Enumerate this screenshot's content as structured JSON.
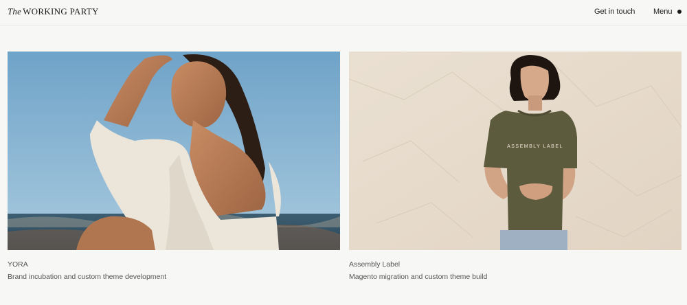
{
  "header": {
    "logo_the": "The",
    "logo_name": "WORKING PARTY",
    "contact_label": "Get in touch",
    "menu_label": "Menu"
  },
  "projects": [
    {
      "title": "YORA",
      "description": "Brand incubation and custom theme development",
      "image_alt": "Smiling woman in linen shirt shading her eyes by the sea"
    },
    {
      "title": "Assembly Label",
      "description": "Magento migration and custom theme build",
      "image_alt": "Woman wearing an olive Assembly Label t-shirt against crumpled paper backdrop",
      "shirt_text": "ASSEMBLY LABEL"
    }
  ],
  "colors": {
    "background": "#f7f7f5",
    "text": "#1a1a1a",
    "muted_text": "#555555",
    "sky": "#8fb8d3",
    "linen": "#ece5da",
    "paper": "#e8dccd",
    "olive": "#5d5b3e"
  }
}
